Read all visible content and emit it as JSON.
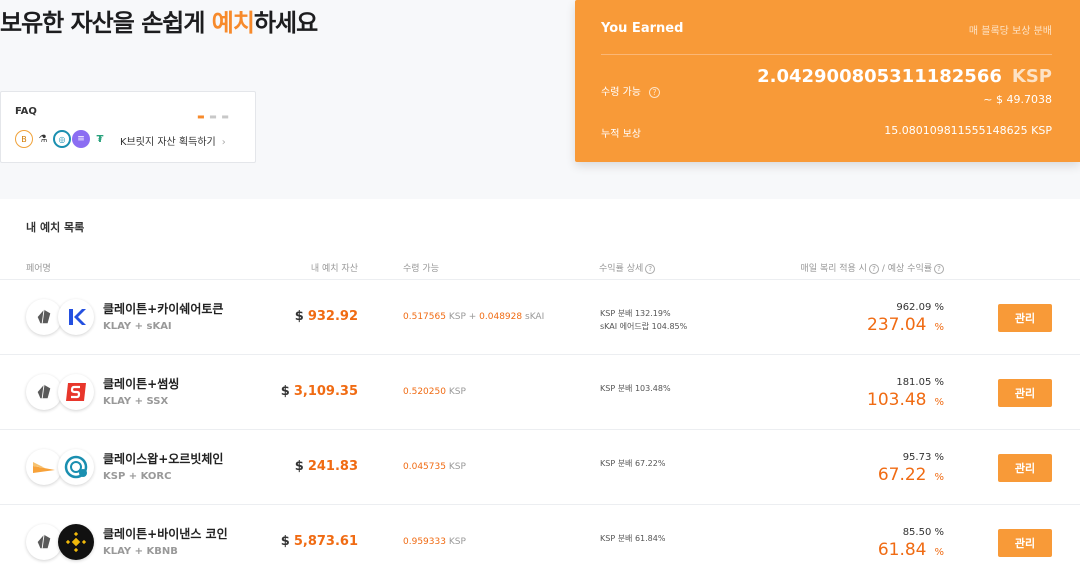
{
  "hero": {
    "title_pre": "보유한 자산을 손쉽게 ",
    "title_accent": "예치",
    "title_post": "하세요"
  },
  "faq": {
    "label": "FAQ",
    "text": "K브릿지 자산 획득하기",
    "chevron": "›"
  },
  "earned": {
    "title": "You Earned",
    "hint": "매 블록당 보상 분배",
    "claimable_label": "수령 가능",
    "claimable_amount": "2.042900805311182566",
    "claimable_unit": "KSP",
    "claimable_usd": "~ $ 49.7038",
    "cumulative_label": "누적 보상",
    "cumulative_amount": "15.080109811555148625 KSP"
  },
  "list": {
    "title": "내 예치 목록",
    "columns": {
      "pair": "페어명",
      "deposit": "내 예치 자산",
      "claimable": "수령 가능",
      "detail": "수익률 상세",
      "apr": "매일 복리 적용 시",
      "apr_suffix": "/ 예상 수익률"
    },
    "manage_label": "관리",
    "rows": [
      {
        "name": "클레이튼+카이쉐어토큰",
        "symbols": "KLAY + sKAI",
        "usd_sign": "$",
        "deposit": "932.92",
        "claim_a": "0.517565",
        "claim_a_unit": "KSP",
        "claim_plus": "+",
        "claim_b": "0.048928",
        "claim_b_unit": "sKAI",
        "detail_1": "KSP 분배 132.19%",
        "detail_2": "sKAI 에어드랍 104.85%",
        "apr_compound": "962.09 %",
        "apr": "237.04",
        "pct": "%"
      },
      {
        "name": "클레이튼+썸씽",
        "symbols": "KLAY + SSX",
        "usd_sign": "$",
        "deposit": "3,109.35",
        "claim_a": "0.520250",
        "claim_a_unit": "KSP",
        "detail_1": "KSP 분배 103.48%",
        "apr_compound": "181.05 %",
        "apr": "103.48",
        "pct": "%"
      },
      {
        "name": "클레이스왑+오르빗체인",
        "symbols": "KSP + KORC",
        "usd_sign": "$",
        "deposit": "241.83",
        "claim_a": "0.045735",
        "claim_a_unit": "KSP",
        "detail_1": "KSP 분배 67.22%",
        "apr_compound": "95.73 %",
        "apr": "67.22",
        "pct": "%"
      },
      {
        "name": "클레이튼+바이낸스 코인",
        "symbols": "KLAY + KBNB",
        "usd_sign": "$",
        "deposit": "5,873.61",
        "claim_a": "0.959333",
        "claim_a_unit": "KSP",
        "detail_1": "KSP 분배 61.84%",
        "apr_compound": "85.50 %",
        "apr": "61.84",
        "pct": "%"
      }
    ]
  },
  "icons": {
    "klay": "klaytn-icon",
    "skai": "kaishare-icon",
    "ssx": "somesing-icon",
    "ksp": "klayswap-icon",
    "korc": "orbit-chain-icon",
    "kbnb": "binance-coin-icon",
    "help": "help-circle-icon"
  },
  "colors": {
    "accent": "#f89a38",
    "accent_text": "#f06b13"
  }
}
